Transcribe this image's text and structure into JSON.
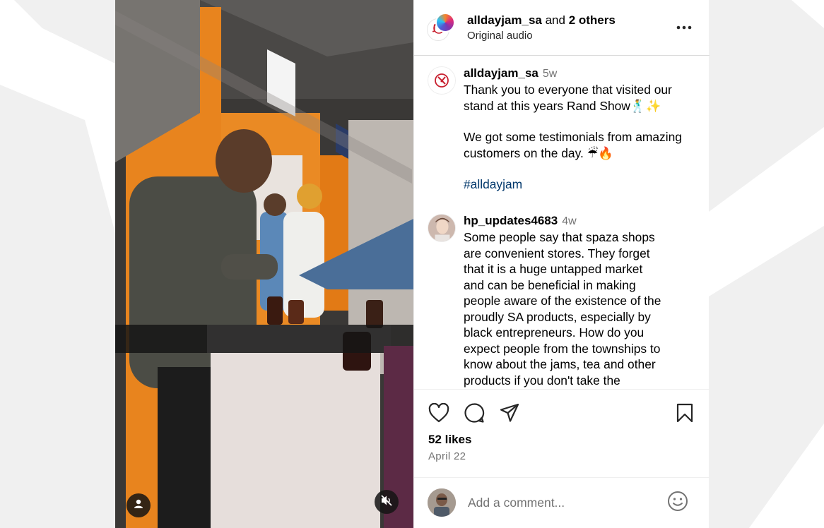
{
  "post": {
    "author": "alldayjam_sa",
    "collab_connector": "and",
    "collab_others": "2 others",
    "audio": "Original audio",
    "more_icon": "more-horizontal-icon"
  },
  "caption": {
    "username": "alldayjam_sa",
    "time": "5w",
    "paragraph1": "Thank you to everyone that visited our\nstand at this years Rand Show🕺✨",
    "paragraph2": "We got some testimonials from amazing\ncustomers on the day. ☔🔥",
    "hashtag": "#alldayjam"
  },
  "comments": [
    {
      "username": "hp_updates4683",
      "time": "4w",
      "text": "Some people say that spaza shops\nare convenient stores. They forget\nthat it is a huge untapped market\nand can be beneficial in making\npeople aware of the existence of the\nproudly SA products, especially by\nblack entrepreneurs. How do you\nexpect people from the townships to\nknow about the jams, tea and other\nproducts if you don't take the"
    }
  ],
  "actions": {
    "like_icon": "heart-icon",
    "comment_icon": "comment-icon",
    "share_icon": "share-icon",
    "save_icon": "bookmark-icon",
    "likes": "52 likes",
    "date": "April 22"
  },
  "add_comment": {
    "placeholder": "Add a comment...",
    "emoji_icon": "emoji-icon"
  },
  "colors": {
    "hashtag": "#00376b",
    "muted": "#737373",
    "booth_orange": "#e8841e"
  }
}
